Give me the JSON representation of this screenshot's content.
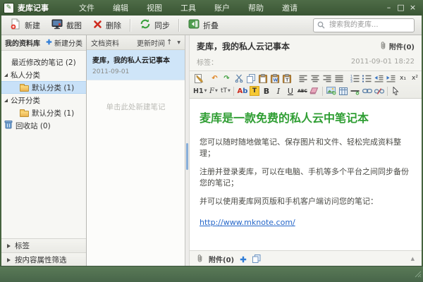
{
  "titlebar": {
    "app_title": "麦库记事",
    "menus": [
      "文件",
      "编辑",
      "视图",
      "工具",
      "账户",
      "帮助",
      "邀请"
    ]
  },
  "icons": {
    "logo_glyph": "✎",
    "minimize": "–",
    "maximize": "□",
    "close": "×",
    "undo": "↶",
    "redo": "↷",
    "caret": "▼",
    "sort_arrow": "↑",
    "collapse_up": "▲"
  },
  "toolbar": {
    "new_label": "新建",
    "screenshot_label": "截图",
    "delete_label": "删除",
    "sync_label": "同步",
    "collapse_label": "折叠",
    "search_placeholder": "搜索我的麦库..."
  },
  "sidebar": {
    "library_title": "我的资料库",
    "new_category_label": "新建分类",
    "items": {
      "recent": "最近修改的笔记 (2)",
      "private_group": "私人分类",
      "private_default": "默认分类 (1)",
      "public_group": "公开分类",
      "public_default": "默认分类 (1)",
      "recycle_bin": "回收站 (0)"
    },
    "sections": {
      "tags": "标签",
      "filter": "按内容属性筛选"
    }
  },
  "notelist": {
    "header": "文档资料",
    "sort_label": "更新时间",
    "note": {
      "title": "麦库，我的私人云记事本",
      "date": "2011-09-01"
    },
    "empty_hint": "单击此处新建笔记"
  },
  "editor": {
    "note_title": "麦库，我的私人云记事本",
    "attachments_label": "附件(0)",
    "tags_label": "标签：",
    "datetime": "2011-09-01 18:22",
    "toolbar": {
      "h1": "H1",
      "font": "F",
      "size": "tT",
      "color_a": "A",
      "color_b": "b",
      "highlight": "T",
      "bold": "B",
      "italic": "I",
      "underline": "U",
      "strike": "ABC",
      "sub": "x₁",
      "sup": "x²"
    },
    "content": {
      "heading": "麦库是一款免费的私人云中笔记本",
      "paragraphs": [
        "您可以随时随地做笔记、保存图片和文件、轻松完成资料整理；",
        "注册并登录麦库，可以在电脑、手机等多个平台之间同步备份您的笔记；",
        "并可以使用麦库网页版和手机客户端访问您的笔记："
      ],
      "link": "http://www.mknote.com/"
    },
    "attach_bar_label": "附件(0)"
  },
  "colors": {
    "titlebar_green": "#4a6843",
    "statusbar_green": "#4f7050",
    "selection_blue": "#c8e1f8",
    "heading_green": "#2f9e33",
    "link_blue": "#2667c9",
    "folder_yellow": "#eab250"
  }
}
